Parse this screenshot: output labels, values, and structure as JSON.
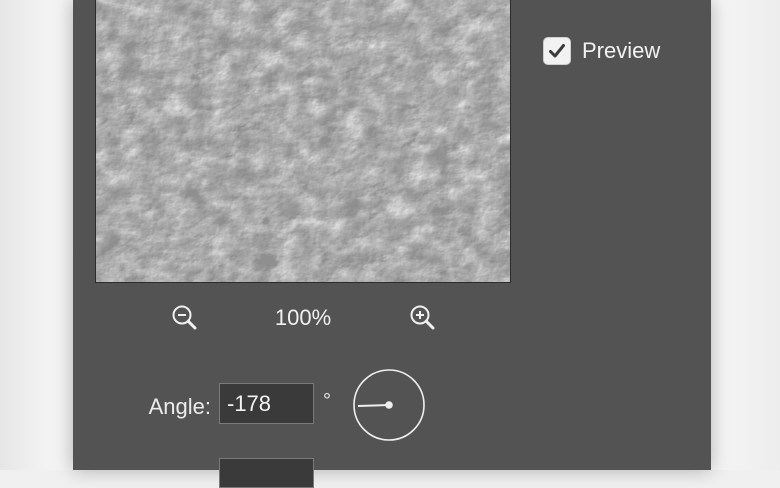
{
  "dialog": {
    "preview": {
      "zoom_level": "100%",
      "zoom_out_icon": "zoom-out-magnifier",
      "zoom_in_icon": "zoom-in-magnifier"
    },
    "preview_checkbox": {
      "label": "Preview",
      "checked": true,
      "check_icon": "checkmark"
    },
    "angle": {
      "label": "Angle:",
      "value": "-178",
      "unit": "°",
      "dial_icon": "angle-dial"
    }
  },
  "colors": {
    "dialog_bg": "#535353",
    "input_bg": "#3a3a3a",
    "text": "#f0f0f0"
  }
}
